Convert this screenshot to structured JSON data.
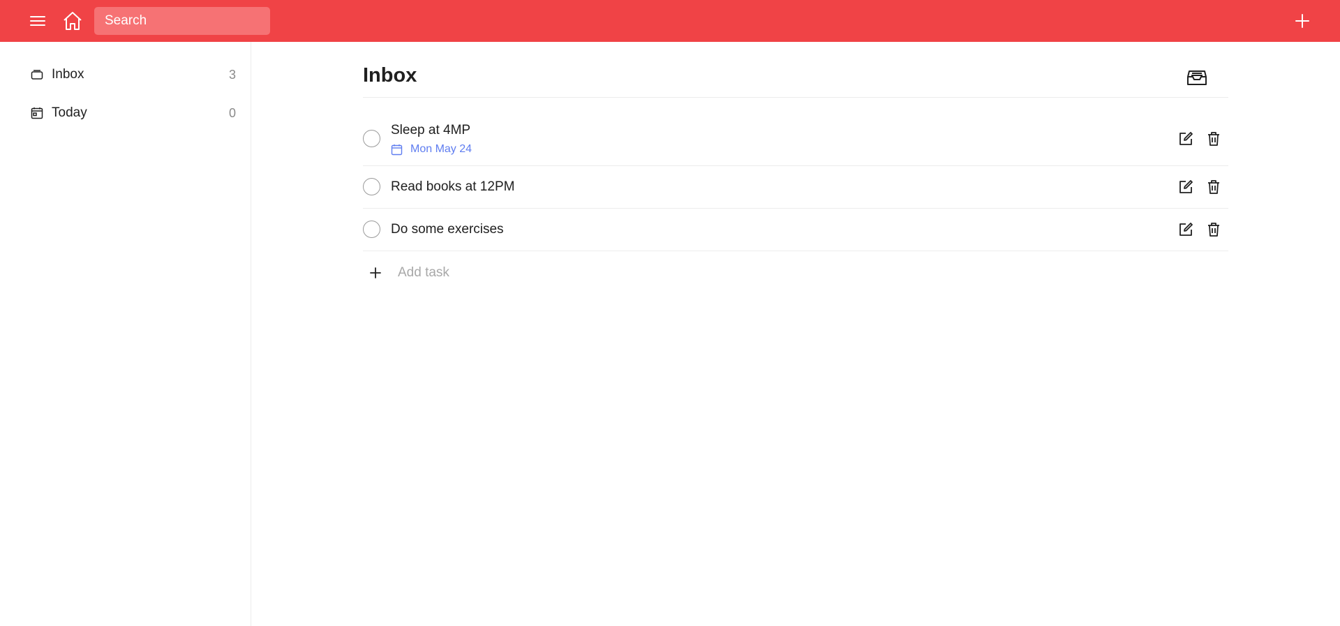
{
  "colors": {
    "accent": "#f04346",
    "search_bg": "#f67274",
    "date_blue": "#5f7df0",
    "muted": "#8a8a8a"
  },
  "topbar": {
    "menu_icon": "hamburger-icon",
    "home_icon": "home-icon",
    "search_placeholder": "Search",
    "add_icon": "plus-icon"
  },
  "sidebar": {
    "items": [
      {
        "label": "Inbox",
        "count": "3",
        "icon": "inbox-icon"
      },
      {
        "label": "Today",
        "count": "0",
        "icon": "calendar-icon"
      }
    ]
  },
  "main": {
    "title": "Inbox",
    "header_icon": "inbox-tray-icon",
    "tasks": [
      {
        "title": "Sleep at 4MP",
        "date": "Mon May 24"
      },
      {
        "title": "Read books at 12PM"
      },
      {
        "title": "Do some exercises"
      }
    ],
    "add_task_label": "Add task"
  }
}
